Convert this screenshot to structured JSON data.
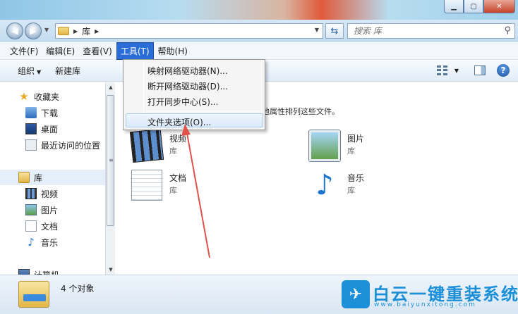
{
  "address": {
    "crumb": "库",
    "search_placeholder": "搜索 库"
  },
  "menubar": {
    "items": [
      "文件(F)",
      "编辑(E)",
      "查看(V)",
      "工具(T)",
      "帮助(H)"
    ]
  },
  "commandbar": {
    "organize": "组织",
    "new_library": "新建库"
  },
  "tools_menu": {
    "items": [
      "映射网络驱动器(N)...",
      "断开网络驱动器(D)...",
      "打开同步中心(S)...",
      "文件夹选项(O)..."
    ]
  },
  "navpane": {
    "favorites": "收藏夹",
    "downloads": "下载",
    "desktop": "桌面",
    "recent": "最近访问的位置",
    "libraries": "库",
    "videos": "视频",
    "pictures": "图片",
    "documents": "文档",
    "music": "音乐",
    "computer": "计算机"
  },
  "content": {
    "description": "期和其他属性排列这些文件。",
    "tiles": [
      {
        "name": "视频",
        "sub": "库"
      },
      {
        "name": "图片",
        "sub": "库"
      },
      {
        "name": "文档",
        "sub": "库"
      },
      {
        "name": "音乐",
        "sub": "库"
      }
    ]
  },
  "status": {
    "count": "4 个对象"
  },
  "watermark": {
    "title": "白云一键重装系统",
    "url": "www.baiyunxitong.com"
  },
  "colors": {
    "menu_highlight": "#2a6dd6",
    "annotation_arrow": "#e0524a",
    "brand_blue": "#1b8fd8"
  }
}
